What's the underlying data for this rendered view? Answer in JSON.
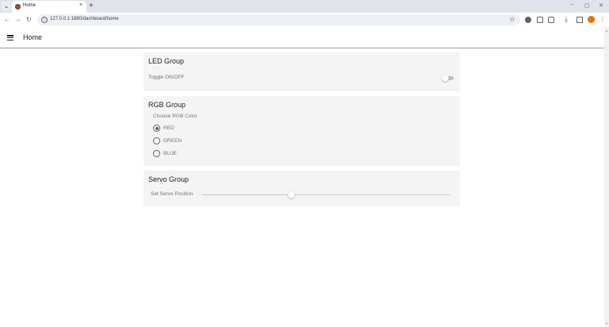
{
  "browser": {
    "tab_title": "Home",
    "tab_close": "×",
    "new_tab": "+",
    "url": "127.0.0.1:1880/dashboard/home",
    "window_controls": {
      "minimize": "−",
      "maximize": "▢",
      "close": "✕"
    },
    "nav": {
      "back": "←",
      "forward": "→",
      "reload": "↻"
    },
    "bookmark_star": "☆",
    "menu": "⋮",
    "icons": [
      "tab-search-icon",
      "extension-a-icon",
      "reading-list-icon",
      "extensions-puzzle-icon",
      "download-icon",
      "side-panel-icon",
      "profile-avatar",
      "menu-kebab-icon"
    ]
  },
  "app": {
    "title": "Home"
  },
  "groups": {
    "led": {
      "title": "LED Group",
      "toggle_label": "Toggle ON/OFF",
      "toggle_on": false
    },
    "rgb": {
      "title": "RGB Group",
      "prompt": "Choose RGB Color",
      "options": [
        {
          "label": "RED",
          "selected": true
        },
        {
          "label": "GREEN",
          "selected": false
        },
        {
          "label": "BLUE",
          "selected": false
        }
      ]
    },
    "servo": {
      "title": "Servo Group",
      "slider_label": "Set Servo Position",
      "slider_fraction": 0.36
    }
  },
  "colors": {
    "card_bg": "#f4f4f4",
    "profile_accent": "#e8710a",
    "app_bar_border": "#9e9e9e"
  }
}
